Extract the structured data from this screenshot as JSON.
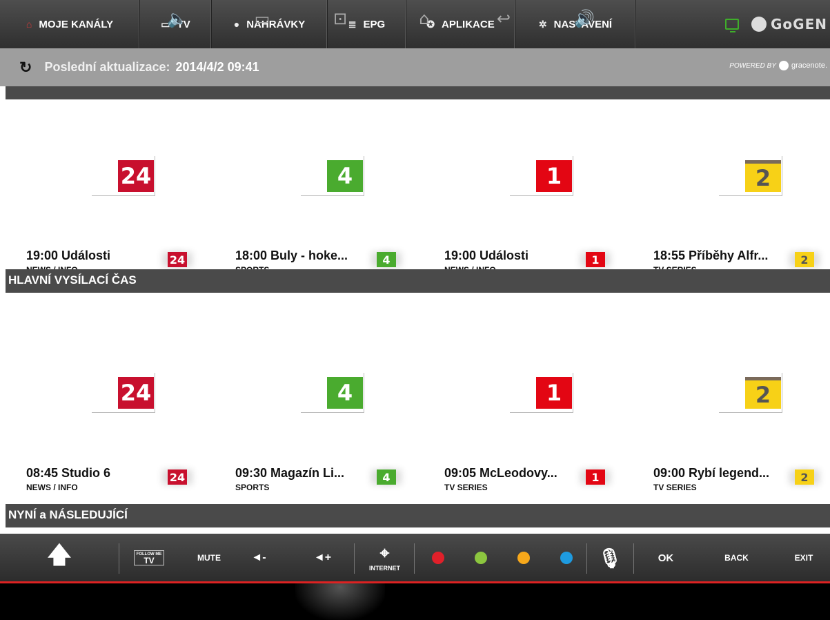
{
  "nav": {
    "items": [
      {
        "icon": "home-icon",
        "label": "MOJE KANÁLY"
      },
      {
        "icon": "tv-icon",
        "label": "TV"
      },
      {
        "icon": "record-icon",
        "label": "NAHRÁVKY"
      },
      {
        "icon": "epg-icon",
        "label": "EPG"
      },
      {
        "icon": "apps-icon",
        "label": "APLIKACE"
      },
      {
        "icon": "gear-icon",
        "label": "NASTAVENÍ"
      }
    ],
    "brand": "GoGEN"
  },
  "update": {
    "label": "Poslední aktualizace:",
    "value": "2014/4/2 09:41",
    "powered": "POWERED BY",
    "gracenote": "gracenote."
  },
  "row1": [
    {
      "logo": "24",
      "program": "19:00 Události",
      "genre": "NEWS / INFO",
      "color": "#c8102e"
    },
    {
      "logo": "4",
      "program": "18:00 Buly - hoke...",
      "genre": "SPORTS",
      "color": "#4aab2f"
    },
    {
      "logo": "1",
      "program": "19:00 Události",
      "genre": "NEWS / INFO",
      "color": "#e30613"
    },
    {
      "logo": "2",
      "program": "18:55 Příběhy Alfr...",
      "genre": "TV SERIES",
      "color": "#f7d117"
    }
  ],
  "section1": "HLAVNÍ VYSÍLACÍ ČAS",
  "row2": [
    {
      "logo": "24",
      "program": "08:45 Studio 6",
      "genre": "NEWS / INFO",
      "color": "#c8102e"
    },
    {
      "logo": "4",
      "program": "09:30 Magazín Li...",
      "genre": "SPORTS",
      "color": "#4aab2f"
    },
    {
      "logo": "1",
      "program": "09:05 McLeodovy...",
      "genre": "TV SERIES",
      "color": "#e30613"
    },
    {
      "logo": "2",
      "program": "09:00 Rybí legend...",
      "genre": "TV SERIES",
      "color": "#f7d117"
    }
  ],
  "section2": "NYNÍ a NÁSLEDUJÍCÍ",
  "remote": {
    "follow_top": "FOLLOW ME",
    "follow_tv": "TV",
    "mute": "MUTE",
    "voldown": "◄-",
    "volup": "◄+",
    "internet": "INTERNET",
    "ok": "OK",
    "back": "BACK",
    "exit": "EXIT",
    "dots": [
      "#e0202a",
      "#8cc63f",
      "#f7a81b",
      "#1e9be0"
    ]
  }
}
